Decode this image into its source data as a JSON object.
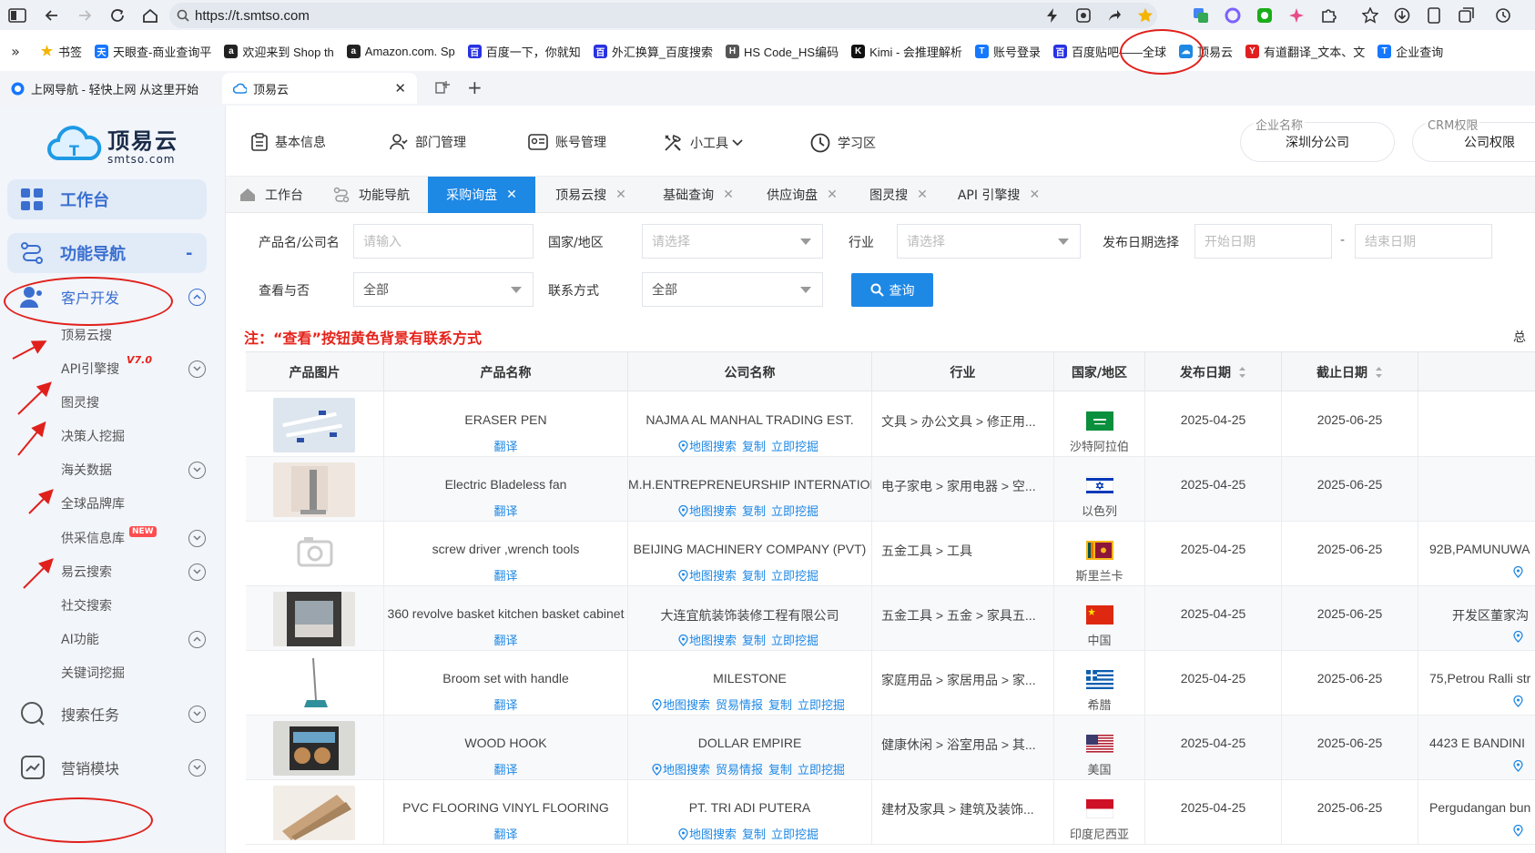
{
  "browser": {
    "url": "https://t.smtso.com",
    "bookmarks": [
      {
        "label": "书签",
        "color": "#f4b400",
        "glyph": "★"
      },
      {
        "label": "天眼查-商业查询平",
        "color": "#1677ff",
        "glyph": "天"
      },
      {
        "label": "欢迎来到 Shop th",
        "color": "#222222",
        "glyph": "a"
      },
      {
        "label": "Amazon.com. Sp",
        "color": "#222222",
        "glyph": "a"
      },
      {
        "label": "百度一下，你就知",
        "color": "#2932e1",
        "glyph": "百"
      },
      {
        "label": "外汇换算_百度搜索",
        "color": "#2932e1",
        "glyph": "百"
      },
      {
        "label": "HS Code_HS编码",
        "color": "#555555",
        "glyph": "H"
      },
      {
        "label": "Kimi - 会推理解析",
        "color": "#111111",
        "glyph": "K"
      },
      {
        "label": "账号登录",
        "color": "#1677ff",
        "glyph": "T"
      },
      {
        "label": "百度贴吧——全球",
        "color": "#2932e1",
        "glyph": "百"
      },
      {
        "label": "顶易云",
        "color": "#1e88e5",
        "glyph": "☁"
      },
      {
        "label": "有道翻译_文本、文",
        "color": "#e02020",
        "glyph": "Y"
      },
      {
        "label": "企业查询",
        "color": "#1677ff",
        "glyph": "T"
      }
    ],
    "tabs": [
      {
        "label": "上网导航 - 轻快上网 从这里开始"
      },
      {
        "label": "顶易云"
      }
    ]
  },
  "sidebar": {
    "logo_title": "顶易云",
    "logo_sub": "smtso.com",
    "workbench": "工作台",
    "nav": "功能导航",
    "nav_toggle": "-",
    "section": "客户开发",
    "items": [
      {
        "label": "顶易云搜",
        "chevron": false
      },
      {
        "label": "API引擎搜",
        "chevron": true,
        "tag": "V7.0"
      },
      {
        "label": "图灵搜",
        "chevron": false
      },
      {
        "label": "决策人挖掘",
        "chevron": false
      },
      {
        "label": "海关数据",
        "chevron": true
      },
      {
        "label": "全球品牌库",
        "chevron": false
      },
      {
        "label": "供采信息库",
        "chevron": true,
        "tag": "NEW"
      },
      {
        "label": "易云搜索",
        "chevron": true
      },
      {
        "label": "社交搜索",
        "chevron": false
      },
      {
        "label": "AI功能",
        "chevron": true
      },
      {
        "label": "关键词挖掘",
        "chevron": false
      }
    ],
    "search_tasks": "搜索任务",
    "marketing": "营销模块"
  },
  "topnav": {
    "items": [
      "基本信息",
      "部门管理",
      "账号管理",
      "小工具",
      "学习区"
    ],
    "company_caption": "企业名称",
    "company_value": "深圳分公司",
    "crm_caption": "CRM权限",
    "crm_value": "公司权限"
  },
  "page_tabs": [
    {
      "label": "工作台"
    },
    {
      "label": "功能导航"
    },
    {
      "label": "采购询盘",
      "active": true
    },
    {
      "label": "顶易云搜"
    },
    {
      "label": "基础查询"
    },
    {
      "label": "供应询盘"
    },
    {
      "label": "图灵搜"
    },
    {
      "label": "API 引擎搜"
    }
  ],
  "filters": {
    "product_label": "产品名/公司名",
    "product_placeholder": "请输入",
    "country_label": "国家/地区",
    "country_placeholder": "请选择",
    "industry_label": "行业",
    "industry_placeholder": "请选择",
    "date_label": "发布日期选择",
    "start_placeholder": "开始日期",
    "date_sep": "-",
    "end_placeholder": "结束日期",
    "viewed_label": "查看与否",
    "viewed_value": "全部",
    "contact_label": "联系方式",
    "contact_value": "全部",
    "query_button": "查询"
  },
  "note": "注：“查看”按钮黄色背景有联系方式",
  "total_label": "总",
  "table": {
    "headers": [
      "产品图片",
      "产品名称",
      "公司名称",
      "行业",
      "国家/地区",
      "发布日期",
      "截止日期"
    ],
    "translate": "翻译",
    "map": "地图搜索",
    "trade": "贸易情报",
    "copy": "复制",
    "mine": "立即挖掘",
    "rows": [
      {
        "product": "ERASER PEN",
        "company": "NAJMA AL MANHAL TRADING EST.",
        "industry": "文具 > 办公文具 > 修正用...",
        "country": "沙特阿拉伯",
        "flag": "sa",
        "publish": "2025-04-25",
        "deadline": "2025-06-25",
        "trade": false,
        "extra": ""
      },
      {
        "product": "Electric Bladeless fan",
        "company": "M.H.ENTREPRENEURSHIP INTERNATIONAL",
        "industry": "电子家电 > 家用电器 > 空...",
        "country": "以色列",
        "flag": "il",
        "publish": "2025-04-25",
        "deadline": "2025-06-25",
        "trade": false,
        "extra": ""
      },
      {
        "product": "screw driver ,wrench tools",
        "company": "BEIJING MACHINERY COMPANY (PVT)",
        "industry": "五金工具 > 工具",
        "country": "斯里兰卡",
        "flag": "lk",
        "publish": "2025-04-25",
        "deadline": "2025-06-25",
        "trade": false,
        "extra": "92B,PAMUNUWA"
      },
      {
        "product": "360 revolve basket kitchen basket cabinet",
        "company": "大连宜航装饰装修工程有限公司",
        "industry": "五金工具 > 五金 > 家具五...",
        "country": "中国",
        "flag": "cn",
        "publish": "2025-04-25",
        "deadline": "2025-06-25",
        "trade": false,
        "extra": "开发区董家沟"
      },
      {
        "product": "Broom set with handle",
        "company": "MILESTONE",
        "industry": "家庭用品 > 家居用品 > 家...",
        "country": "希腊",
        "flag": "gr",
        "publish": "2025-04-25",
        "deadline": "2025-06-25",
        "trade": true,
        "extra": "75,Petrou Ralli str"
      },
      {
        "product": "WOOD HOOK",
        "company": "DOLLAR EMPIRE",
        "industry": "健康休闲 > 浴室用品 > 其...",
        "country": "美国",
        "flag": "us",
        "publish": "2025-04-25",
        "deadline": "2025-06-25",
        "trade": true,
        "extra": "4423 E BANDINI"
      },
      {
        "product": "PVC FLOORING VINYL FLOORING",
        "company": "PT. TRI ADI PUTERA",
        "industry": "建材及家具 > 建筑及装饰...",
        "country": "印度尼西亚",
        "flag": "id",
        "publish": "2025-04-25",
        "deadline": "2025-06-25",
        "trade": false,
        "extra": "Pergudangan bun"
      }
    ]
  },
  "colors": {
    "accent": "#1e88e5",
    "annotation": "#e0201b",
    "note": "#e5231b"
  }
}
